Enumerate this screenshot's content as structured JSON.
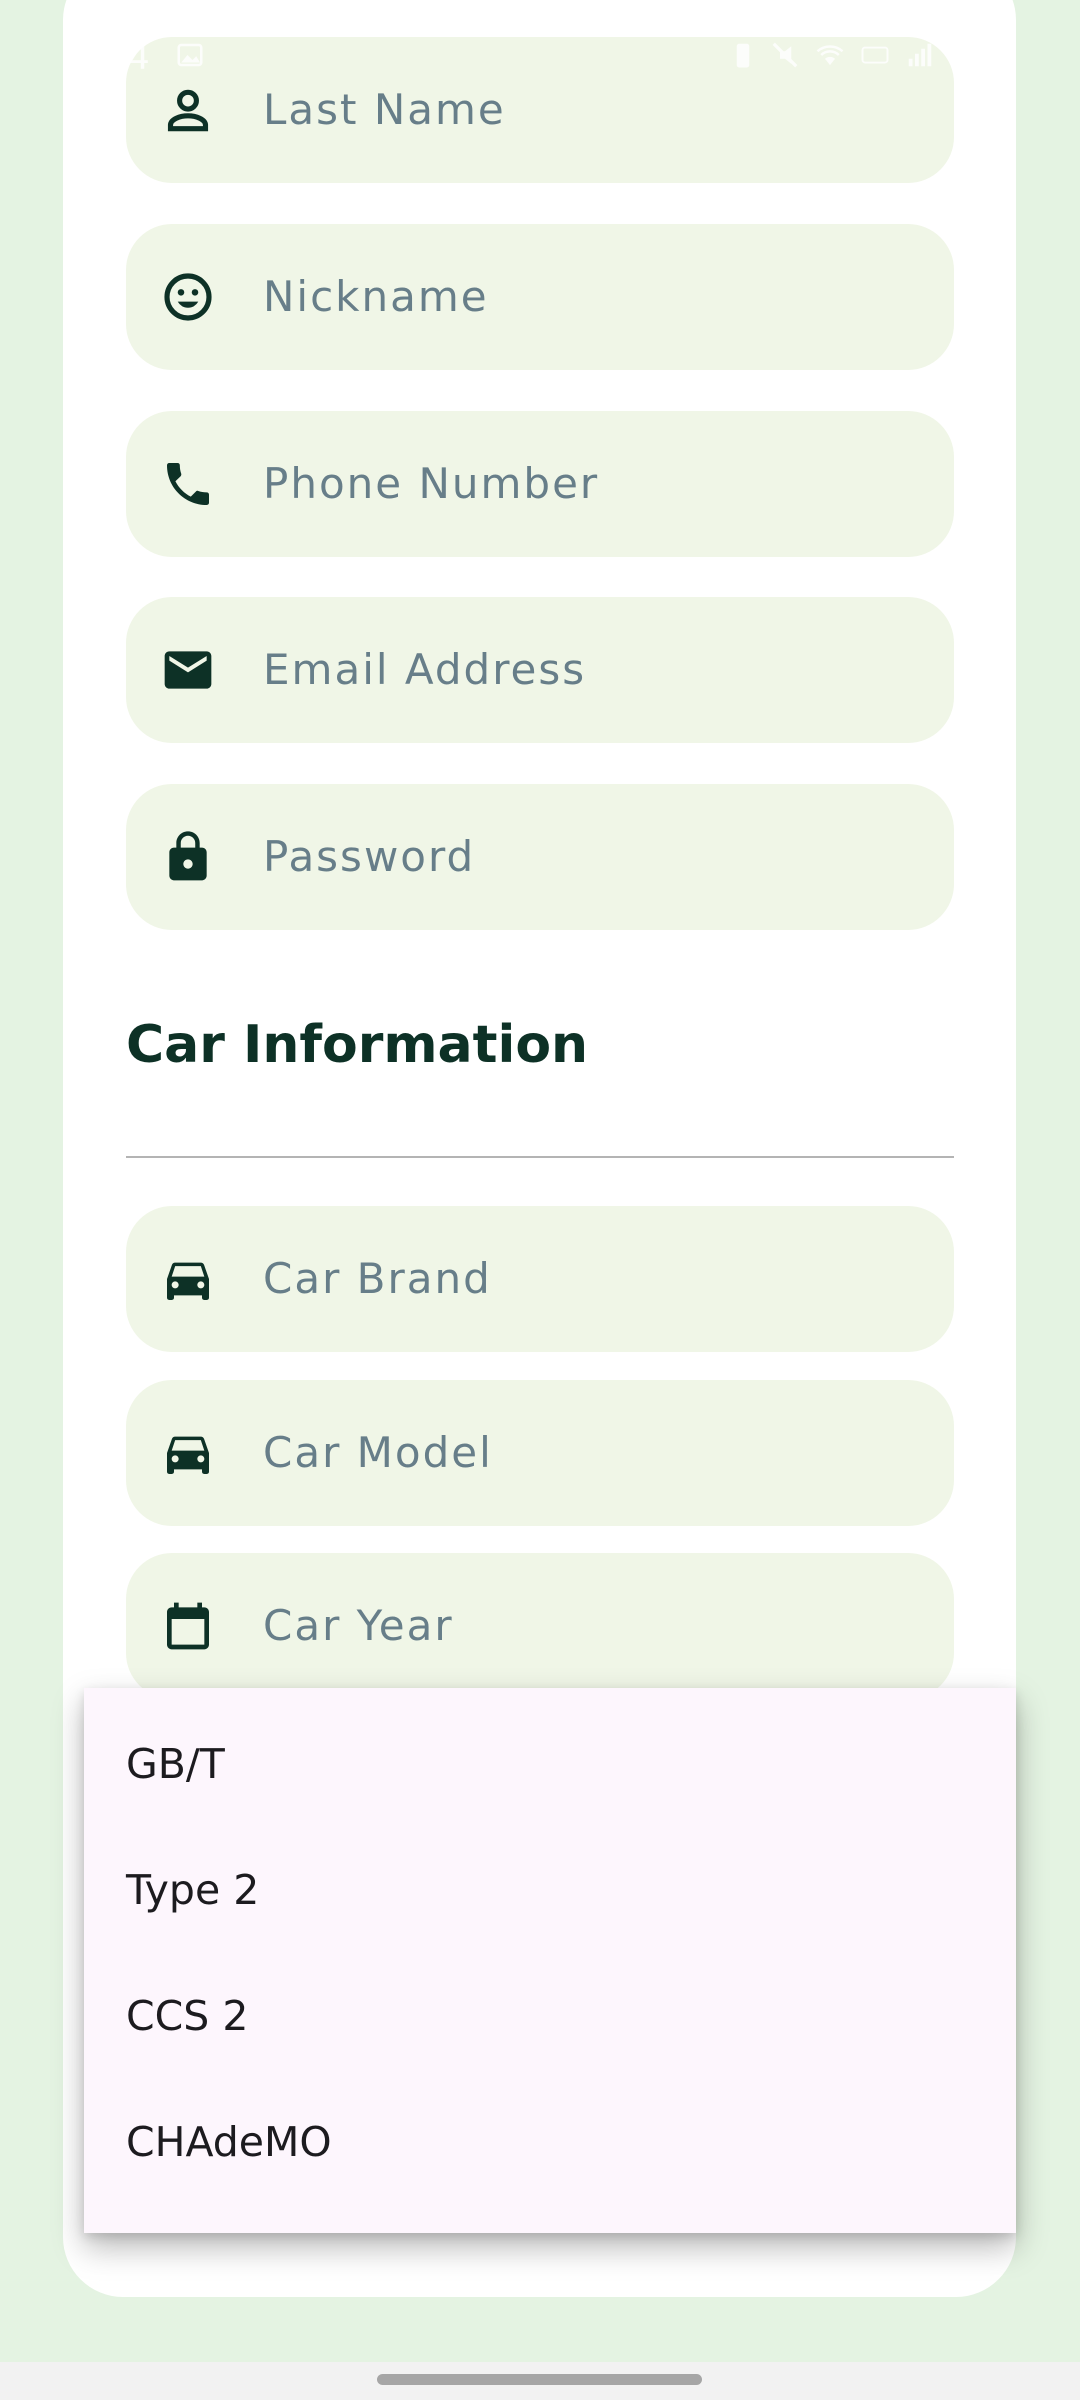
{
  "status_bar": {
    "time": "4"
  },
  "fields": {
    "last_name": {
      "placeholder": "Last Name",
      "icon": "person-icon"
    },
    "nickname": {
      "placeholder": "Nickname",
      "icon": "smiley-face-icon"
    },
    "phone": {
      "placeholder": "Phone Number",
      "icon": "phone-icon"
    },
    "email": {
      "placeholder": "Email Address",
      "icon": "mail-icon"
    },
    "password": {
      "placeholder": "Password",
      "icon": "lock-icon"
    },
    "car_brand": {
      "placeholder": "Car Brand",
      "icon": "car-icon"
    },
    "car_model": {
      "placeholder": "Car Model",
      "icon": "car-icon"
    },
    "car_year": {
      "placeholder": "Car Year",
      "icon": "calendar-icon"
    }
  },
  "section": {
    "car_information": "Car Information"
  },
  "dropdown_menu": {
    "options": [
      "GB/T",
      "Type 2",
      "CCS 2",
      "CHAdeMO"
    ]
  },
  "colors": {
    "background": "#e4f3e2",
    "field_fill": "#f0f6e7",
    "icon_dark": "#0d3126",
    "placeholder_text": "#677e89",
    "menu_fill": "#fdf6fd"
  }
}
